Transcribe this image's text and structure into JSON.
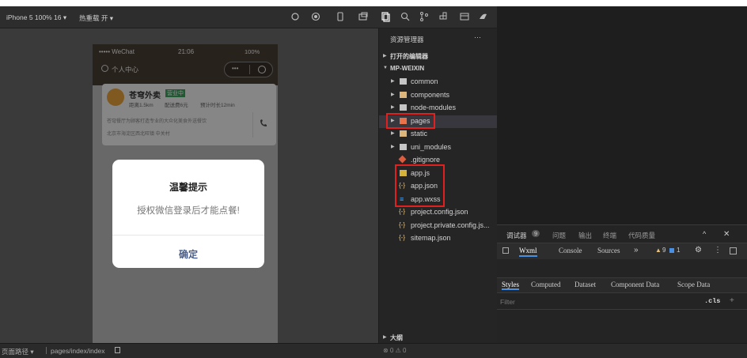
{
  "toolbar": {
    "device": "iPhone 5 100% 16 ▾",
    "hot_reload": "热重载 开 ▾"
  },
  "phone": {
    "carrier": "••••• WeChat",
    "time": "21:06",
    "battery": "100%",
    "user_center": "个人中心",
    "shop_name": "苍穹外卖",
    "shop_status": "营业中",
    "shop_distance": "距离1.5km",
    "shop_fee": "配送费6元",
    "shop_time": "预计时长12min",
    "shop_desc": "苍穹餐厅为顾客打造专业的大众化美食外送餐饮",
    "shop_address": "北京市海淀区西北旺镇 中关村"
  },
  "dialog": {
    "title": "温馨提示",
    "message": "授权微信登录后才能点餐!",
    "confirm": "确定"
  },
  "explorer": {
    "header": "资源管理器",
    "more": "···",
    "open_editors": "打开的编辑器",
    "project": "MP-WEIXIN",
    "items": [
      {
        "label": "common"
      },
      {
        "label": "components"
      },
      {
        "label": "node-modules"
      },
      {
        "label": "pages"
      },
      {
        "label": "static"
      },
      {
        "label": "uni_modules"
      },
      {
        "label": ".gitignore"
      },
      {
        "label": "app.js"
      },
      {
        "label": "app.json"
      },
      {
        "label": "app.wxss"
      },
      {
        "label": "project.config.json"
      },
      {
        "label": "project.private.config.js..."
      },
      {
        "label": "sitemap.json"
      }
    ],
    "outline": "大纲"
  },
  "devtools": {
    "tabs": [
      "调试器",
      "问题",
      "输出",
      "终端",
      "代码质量"
    ],
    "debugger_badge": "9",
    "subtabs": [
      "Wxml",
      "Console",
      "Sources",
      "»"
    ],
    "warn_count": "9",
    "error_count": "1",
    "styles_tabs": [
      "Styles",
      "Computed",
      "Dataset",
      "Component Data",
      "Scope Data"
    ],
    "filter_placeholder": "Filter",
    "cls": ".cls",
    "plus": "+"
  },
  "statusbar": {
    "path_label": "页面路径 ▾",
    "path": "pages/index/index",
    "counts": "⊗ 0 ⚠ 0"
  },
  "colors": {
    "highlight_box": "#e12020",
    "folder": "#dcb67a",
    "pages_folder": "#e8734a",
    "json": "#e5c07b",
    "css": "#4da6ff"
  }
}
